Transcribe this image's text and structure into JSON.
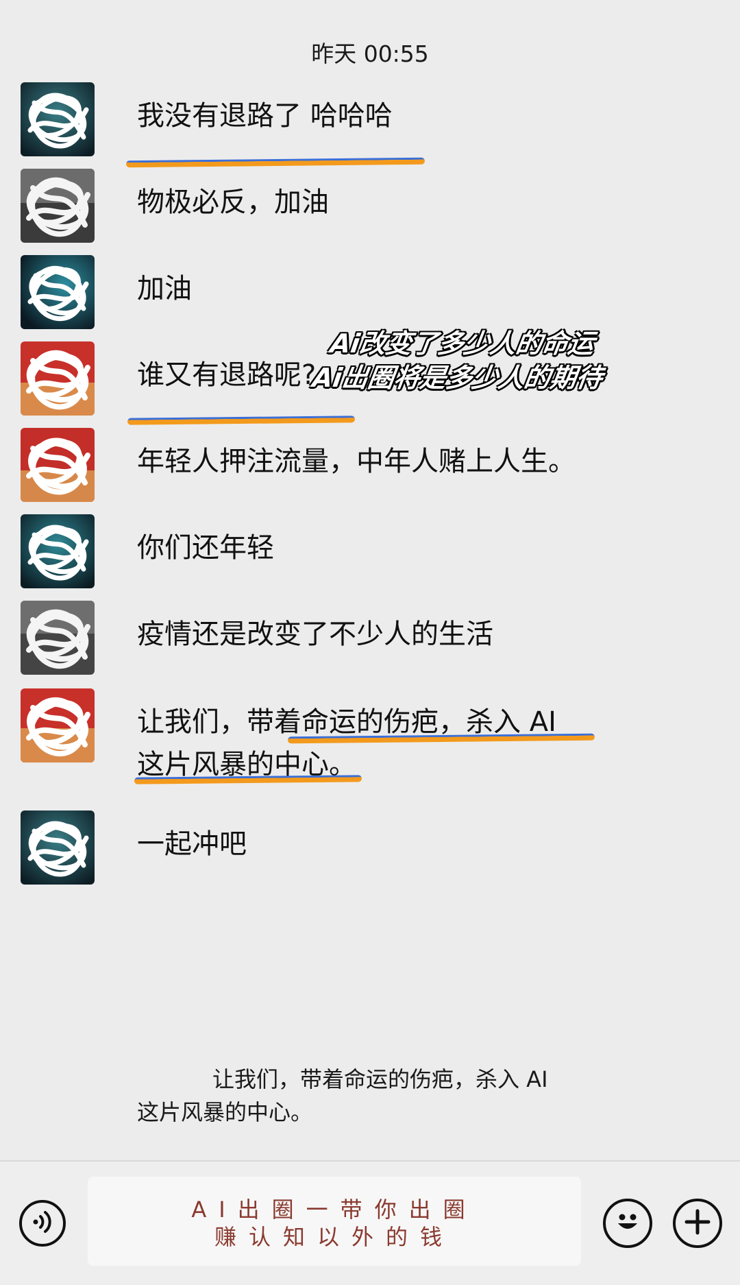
{
  "timestamp": "昨天 00:55",
  "messages": [
    {
      "text": "我没有退路了 哈哈哈"
    },
    {
      "text": "物极必反，加油"
    },
    {
      "text": "加油"
    },
    {
      "text": "谁又有退路呢?"
    },
    {
      "text": "年轻人押注流量，中年人赌上人生。"
    },
    {
      "text": "你们还年轻"
    },
    {
      "text": "疫情还是改变了不少人的生活"
    },
    {
      "text": "让我们，带着命运的伤疤，杀入 AI\n这片风暴的中心。"
    },
    {
      "text": "一起冲吧"
    }
  ],
  "overlay_caption": {
    "line1": "Ai改变了多少人的命运",
    "line2": "Ai出圈将是多少人的期待"
  },
  "quote_caption": "让我们，带着命运的伤疤，杀入 AI\n这片风暴的中心。",
  "input_bar": {
    "text": "AI出圈一带你出圈\n赚认知以外的钱"
  },
  "icons": {
    "voice": "voice-icon",
    "emoji": "emoji-icon",
    "add": "add-icon"
  },
  "colors": {
    "underline_orange": "#f39a1d",
    "underline_blue": "#3b6fd8",
    "input_text": "#8a3a2f"
  }
}
